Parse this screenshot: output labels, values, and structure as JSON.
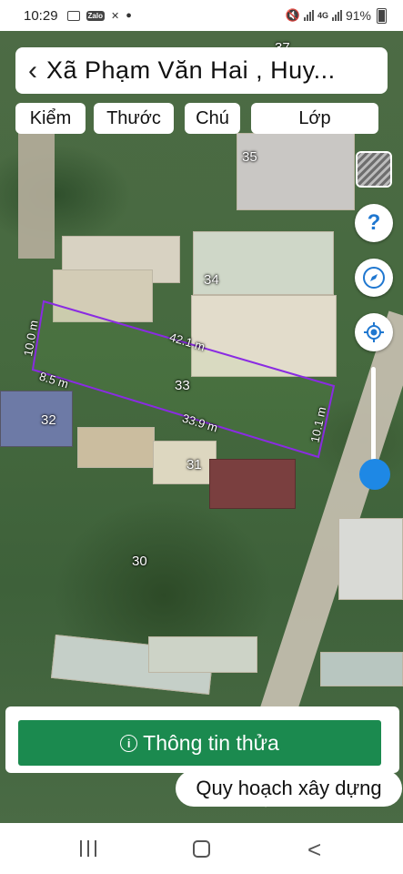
{
  "status": {
    "time": "10:29",
    "icons_left": [
      "image-icon",
      "zalo-icon",
      "cross-icon",
      "dot-icon"
    ],
    "network": "4G",
    "battery": "91%"
  },
  "header": {
    "title": "Xã Phạm Văn Hai , Huy..."
  },
  "tabs": [
    {
      "label": "Kiểm"
    },
    {
      "label": "Thước"
    },
    {
      "label": "Chú"
    },
    {
      "label": "Lớp"
    }
  ],
  "map": {
    "parcels": {
      "p37": "37",
      "p35": "35",
      "p34": "34",
      "p33": "33",
      "p32": "32",
      "p31": "31",
      "p30": "30"
    },
    "dimensions": {
      "top": "42.1 m",
      "left": "10.0 m",
      "bottom_left": "8.5 m",
      "bottom": "33.9 m",
      "right": "10.1 m"
    },
    "highlight_color": "#8a2be2"
  },
  "controls": {
    "help_symbol": "?",
    "icons": [
      "layers-icon",
      "help-icon",
      "compass-icon",
      "my-location-icon"
    ]
  },
  "bottom": {
    "info_button": "Thông tin thửa",
    "info_icon_symbol": "i",
    "plan_button": "Quy hoạch xây dựng",
    "accent_color": "#1b8a4f"
  },
  "nav": {
    "back_symbol": "<"
  }
}
